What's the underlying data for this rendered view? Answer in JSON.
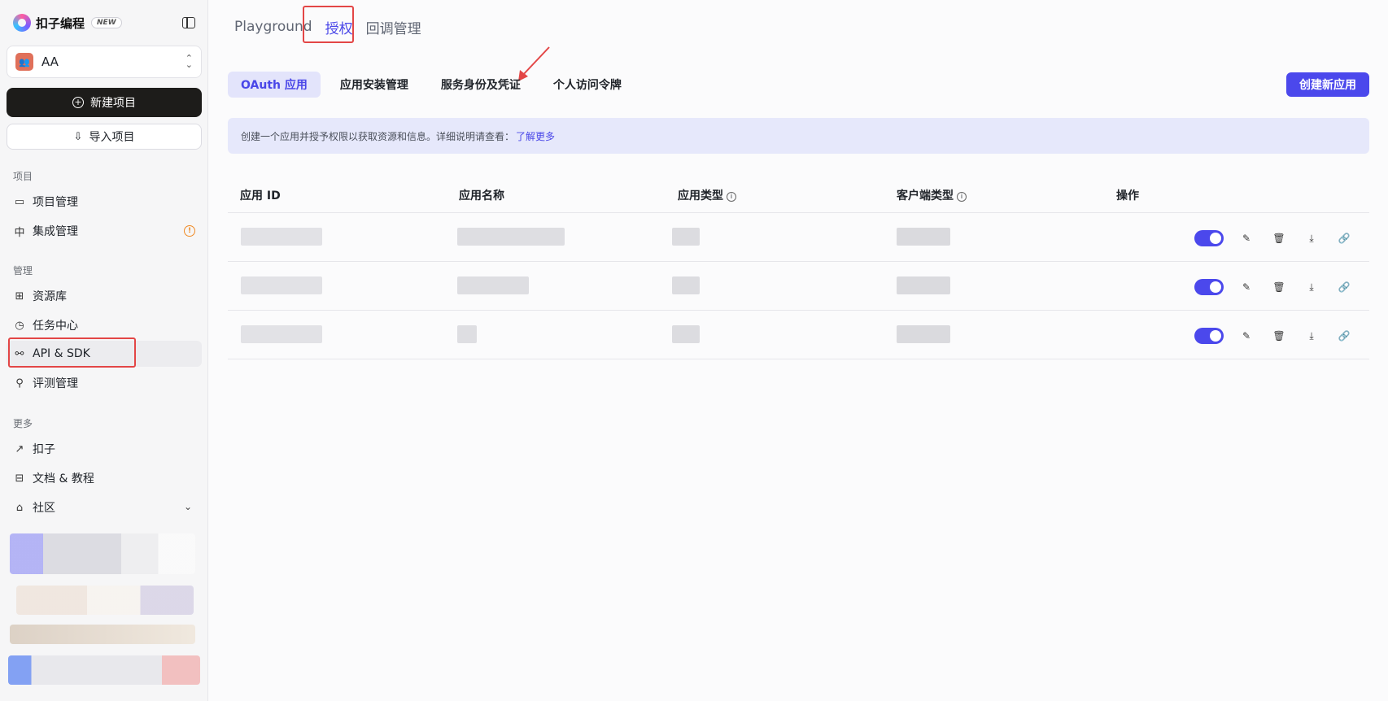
{
  "brand": {
    "name": "扣子编程",
    "badge": "NEW"
  },
  "workspace": {
    "avatar_glyph": "👥",
    "name": "AA"
  },
  "sidebar": {
    "new_project": "新建项目",
    "import_project": "导入项目",
    "sections": [
      {
        "label": "项目",
        "items": [
          {
            "label": "项目管理",
            "icon": "folder-icon"
          },
          {
            "label": "集成管理",
            "icon": "integration-icon",
            "warning": true
          }
        ]
      },
      {
        "label": "管理",
        "items": [
          {
            "label": "资源库",
            "icon": "grid-icon"
          },
          {
            "label": "任务中心",
            "icon": "clock-icon"
          },
          {
            "label": "API & SDK",
            "icon": "api-icon",
            "active": true
          },
          {
            "label": "评测管理",
            "icon": "telescope-icon"
          }
        ]
      },
      {
        "label": "更多",
        "items": [
          {
            "label": "扣子",
            "icon": "arrow-up-right-icon"
          },
          {
            "label": "文档 & 教程",
            "icon": "map-icon"
          },
          {
            "label": "社区",
            "icon": "store-icon",
            "expandable": true
          }
        ]
      }
    ]
  },
  "top_tabs": [
    {
      "label": "Playground"
    },
    {
      "label": "授权",
      "active": true
    },
    {
      "label": "回调管理"
    }
  ],
  "sub_tabs": [
    {
      "label": "OAuth 应用",
      "active": true
    },
    {
      "label": "应用安装管理"
    },
    {
      "label": "服务身份及凭证"
    },
    {
      "label": "个人访问令牌"
    }
  ],
  "create_button": "创建新应用",
  "banner": {
    "text": "创建一个应用并授予权限以获取资源和信息。详细说明请查看：",
    "link": "了解更多"
  },
  "table": {
    "columns": [
      {
        "label": "应用 ID"
      },
      {
        "label": "应用名称"
      },
      {
        "label": "应用类型",
        "info": true
      },
      {
        "label": "客户端类型",
        "info": true
      },
      {
        "label": "操作"
      }
    ],
    "rows": [
      {
        "enabled": true
      },
      {
        "enabled": true
      },
      {
        "enabled": true
      }
    ],
    "actions": [
      "edit-icon",
      "delete-icon",
      "download-icon",
      "link-icon"
    ]
  },
  "colors": {
    "accent": "#4b48ec",
    "highlight": "#e34646",
    "sidebar_bg": "#f6f6f7",
    "banner_bg": "#e6e8fb"
  }
}
